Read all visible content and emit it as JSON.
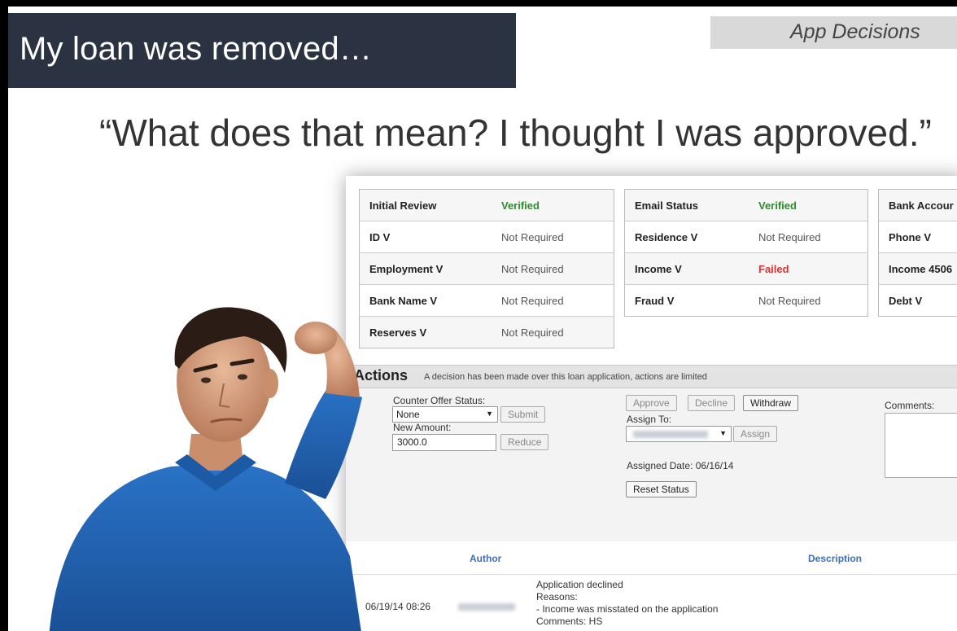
{
  "slide": {
    "title": "My loan was removed…",
    "section": "App Decisions",
    "quote": "“What does that mean? I thought I was approved.”"
  },
  "verification": {
    "col1": [
      {
        "label": "Initial Review",
        "status": "Verified",
        "state": "ok"
      },
      {
        "label": "ID V",
        "status": "Not Required"
      },
      {
        "label": "Employment V",
        "status": "Not Required"
      },
      {
        "label": "Bank Name V",
        "status": "Not Required"
      },
      {
        "label": "Reserves V",
        "status": "Not Required"
      }
    ],
    "col2": [
      {
        "label": "Email Status",
        "status": "Verified",
        "state": "ok"
      },
      {
        "label": "Residence V",
        "status": "Not Required"
      },
      {
        "label": "Income V",
        "status": "Failed",
        "state": "bad"
      },
      {
        "label": "Fraud V",
        "status": "Not Required"
      }
    ],
    "col3": [
      {
        "label": "Bank Accour"
      },
      {
        "label": "Phone V"
      },
      {
        "label": "Income 4506"
      },
      {
        "label": "Debt V"
      }
    ]
  },
  "actions": {
    "title": "Actions",
    "note": "A decision has been made over this loan application, actions are limited",
    "counter_offer_label": "Counter Offer Status:",
    "counter_offer_value": "None",
    "submit": "Submit",
    "new_amount_label": "New Amount:",
    "new_amount_value": "3000.0",
    "reduce": "Reduce",
    "approve": "Approve",
    "decline": "Decline",
    "withdraw": "Withdraw",
    "assign_to_label": "Assign To:",
    "assign": "Assign",
    "assigned_date": "Assigned Date: 06/16/14",
    "reset_status": "Reset Status",
    "comments_label": "Comments:"
  },
  "log": {
    "author_header": "Author",
    "description_header": "Description",
    "rows": [
      {
        "date": "06/19/14 08:26",
        "line1": "Application declined",
        "line2": "Reasons:",
        "line3": "- Income was misstated on the application",
        "line4": "Comments: HS"
      }
    ]
  },
  "colors": {
    "title_bar": "#2b3342",
    "verified": "#2e8b2e",
    "failed": "#e23030",
    "log_header": "#3b6fb6"
  }
}
